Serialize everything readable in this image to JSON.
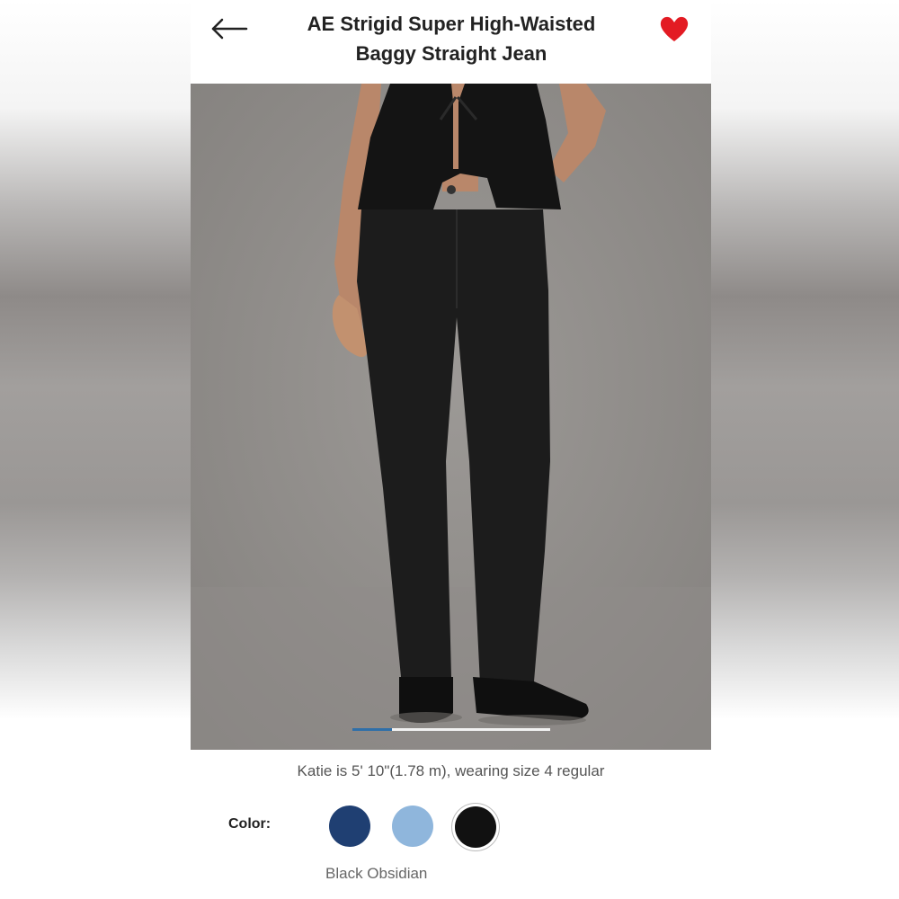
{
  "header": {
    "title_line1": "AE Strigid Super High-Waisted",
    "title_line2": "Baggy Straight Jean",
    "back_icon": "arrow-left-icon",
    "favorite_icon": "heart-filled-icon",
    "favorite_color": "#e31b23"
  },
  "gallery": {
    "carousel_progress": 0.2
  },
  "model_info": "Katie is 5' 10\"(1.78 m), wearing size 4 regular",
  "color_picker": {
    "label": "Color:",
    "selected_name": "Black Obsidian",
    "swatches": [
      {
        "color": "#1f3f72"
      },
      {
        "color": "#8fb6dc"
      },
      {
        "color": "#111111",
        "selected": true
      }
    ]
  }
}
